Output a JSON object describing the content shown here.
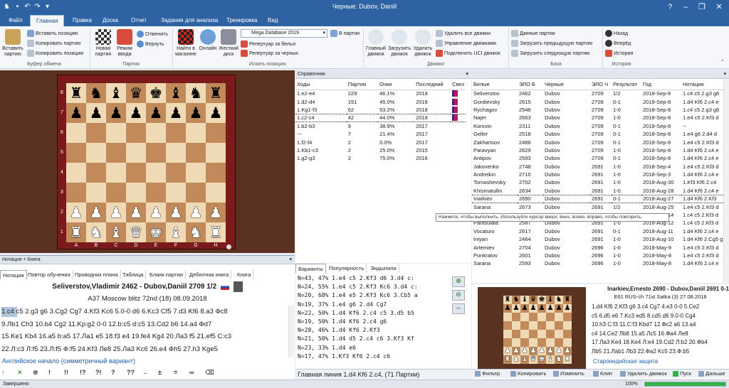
{
  "window": {
    "title": "Черные: Dubov, Daniil"
  },
  "menu": {
    "tabs": [
      "Файл",
      "Главная",
      "Правка",
      "Доска",
      "Отчет",
      "Задания для анализа",
      "Тренировка",
      "Вид"
    ]
  },
  "ribbon": {
    "paste": "Вставить\nпартию",
    "insert_pos": "Вставить позицию",
    "copy_game": "Копировать партию",
    "copy_pos": "Копировать позицию",
    "grp_clip": "Буфер обмена",
    "new_game": "Новая\nпартия",
    "input_mode": "Режим\nввода",
    "undo": "Отменить",
    "redo": "Вернуть",
    "grp_game": "Партия",
    "find_shop": "Найти в\nмагазине",
    "online": "Онлайн",
    "hard_disk": "Жесткий\nдиск",
    "database_value": "Mega Database 2019",
    "in_game": "В партии",
    "rep_white": "Репертуар за белых",
    "rep_black": "Репертуар за черных",
    "grp_search": "Искать позицию",
    "main_engine": "Главный\nдвижок",
    "load_engine": "Загрузить\nдвижок",
    "remove_engine": "Удалить\nдвижок",
    "remove_all": "Удалить все движки",
    "manage": "Управление движками",
    "uci": "Подключить UCI движок",
    "grp_engines": "Движки",
    "game_data": "Данные партии",
    "load_prev": "Загрузить предыдущую партию",
    "load_next": "Загрузить следующую партию",
    "grp_base": "База",
    "back": "Назад",
    "forward": "Вперёд",
    "history": "История",
    "grp_history": "История"
  },
  "board": {
    "ranks": [
      "8",
      "7",
      "6",
      "5",
      "4",
      "3",
      "2",
      "1"
    ],
    "files": [
      "A",
      "B",
      "C",
      "D",
      "E",
      "F",
      "G",
      "H"
    ],
    "position": [
      [
        "r",
        "n",
        "b",
        "q",
        "k",
        "b",
        "n",
        "r"
      ],
      [
        "p",
        "p",
        "p",
        "p",
        "p",
        "p",
        "p",
        "p"
      ],
      [
        "",
        "",
        "",
        "",
        "",
        "",
        "",
        ""
      ],
      [
        "",
        "",
        "",
        "",
        "",
        "",
        "",
        ""
      ],
      [
        "",
        "",
        "",
        "",
        "",
        "",
        "",
        ""
      ],
      [
        "",
        "",
        "",
        "",
        "",
        "",
        "",
        ""
      ],
      [
        "P",
        "P",
        "P",
        "P",
        "P",
        "P",
        "P",
        "P"
      ],
      [
        "R",
        "N",
        "B",
        "Q",
        "K",
        "B",
        "N",
        "R"
      ]
    ]
  },
  "notation": {
    "header": "Нотация + Книга",
    "tabs": [
      "Нотация",
      "Повтор обучения",
      "Проводник плана",
      "Таблица",
      "Бланк партии",
      "Дебютная книга",
      "Книга"
    ],
    "players": "Seliverstov,Vladimir 2462 - Dubov,Daniil 2709  1/2",
    "event": "A37 Moscow blitz 72nd (18) 08.09.2018",
    "lines": [
      "1.c4  c5 2.g3 g6 3.Cg2 Cg7 4.Kf3 Kc6 5.0-0 d6 6.Kc3 Cf5 7.d3 Kf6 8.a3 Фc8",
      "9.Лb1 Ch3 10.b4 Cg2 11.Kp:g2 0-0 12.b:c5 d:c5 13.Cd2 b6 14.a4 Фd7",
      "15.Ke1 Kb4 16.a5 b:a5 17.Лa1 e5 18.f3 e4 19.fe4 Kg4 20.Лa3 f5 21.ef5 C:c3",
      "22.Л:c3 Л:f5 23.Л:f5 Ф:f5 24.Kf3 Лe8 25.Лa3 Kc6 26.e4 Фh5 27.h3 Kge5"
    ],
    "opening": "Английское начало (симметричный вариант)",
    "symbols": [
      "↑",
      "✕",
      "⊕",
      "!",
      "!!",
      "!?",
      "?!",
      "?",
      "??",
      "←",
      "±",
      "=",
      "∞",
      "⌫"
    ]
  },
  "reference": {
    "header": "Справочник",
    "columns": [
      "Ходы",
      "Партии",
      "Очки",
      "Последний",
      "Свез"
    ],
    "rows": [
      [
        "1.e2-e4",
        "229",
        "46.1%",
        "2018"
      ],
      [
        "1.d2-d4",
        "191",
        "45.0%",
        "2018"
      ],
      [
        "1.Kg1-f3",
        "62",
        "53.2%",
        "2018"
      ],
      [
        "1.c2-c4",
        "42",
        "44.0%",
        "2018"
      ],
      [
        "1.b2-b3",
        "9",
        "38.9%",
        "2017"
      ],
      [
        "---",
        "7",
        "21.4%",
        "2017"
      ],
      [
        "1.f2-f4",
        "2",
        "0.0%",
        "2017"
      ],
      [
        "1.Kb1-c3",
        "2",
        "25.0%",
        "2015"
      ],
      [
        "1.g2-g3",
        "2",
        "75.0%",
        "2016"
      ]
    ],
    "selected_row": 3
  },
  "variants": {
    "tabs": [
      "Варианты",
      "Популярность",
      "Эндшпили"
    ],
    "lines": [
      "N=43, 47%  1.e4 c5 2.Kf3 d6 3.d4 c:",
      "N=24, 55%  1.e4 c5 2.Kf3 Kc6 3.d4 c:",
      "N=20, 68%  1.e4 e5 2.Kf3 Kc6 3.Cb5 a",
      "N=19, 37%  1.e4 g6 2.d4 Cg7",
      "N=22, 50%  1.d4 Kf6 2.c4 c5 3.d5 b5",
      "N=19, 50%  1.d4 Kf6 2.c4 g6",
      "N=28, 46%  1.d4 Kf6 2.Kf3",
      "N=21, 50%  1.d4 d5 2.c4 c6 3.Kf3 Kf",
      "N=23, 33%  1.d4 e6",
      "N=17, 47%  1.Kf3 Kf6 2.c4 c6"
    ],
    "footer": "Главная линия 1.d4 Kf6 2.c4, (71 Партии)"
  },
  "games": {
    "columns": [
      "Белые",
      "ЭЛО Б",
      "Черные",
      "ЭЛО Ч",
      "Результат",
      "Год",
      "Нотация"
    ],
    "rows": [
      [
        "Seliverstov",
        "2462",
        "Dubov",
        "2709",
        "1/2",
        "2018-Sep-8",
        "1.c4 c5 2.g3 g6"
      ],
      [
        "Gordievsky",
        "2615",
        "Dubov",
        "2709",
        "0-1",
        "2018-Sep-8",
        "1.d4 Kf6 2.c4 e"
      ],
      [
        "Rychagov",
        "2548",
        "Dubov",
        "2709",
        "1-0",
        "2018-Sep-8",
        "1.c4 c5 2.g3 g6"
      ],
      [
        "Najer",
        "2663",
        "Dubov",
        "2709",
        "1-0",
        "2018-Sep-8",
        "1.e4 c5 2.Kf3 d"
      ],
      [
        "Korovin",
        "2311",
        "Dubov",
        "2709",
        "0-1",
        "2018-Sep-8",
        "--"
      ],
      [
        "Geller",
        "2518",
        "Dubov",
        "2709",
        "0-1",
        "2018-Sep-8",
        "1.e4 g6 2.d4 d"
      ],
      [
        "Zakhartsov",
        "2486",
        "Dubov",
        "2709",
        "0-1",
        "2018-Sep-8",
        "1.e4 c5 2.Kf3 d"
      ],
      [
        "Paravyan",
        "2629",
        "Dubov",
        "2709",
        "1-0",
        "2018-Sep-8",
        "1.d4 Kf6 2.c4 e"
      ],
      [
        "Antipov",
        "2593",
        "Dubov",
        "2709",
        "0-1",
        "2018-Sep-8",
        "1.d4 Kf6 2.c4 e"
      ],
      [
        "Jakovenko",
        "2748",
        "Dubov",
        "2691",
        "1-0",
        "2018-Sep-4",
        "1.e4 c5 2.Kf3 d"
      ],
      [
        "Andreikin",
        "2710",
        "Dubov",
        "2691",
        "1-0",
        "2018-Sep-3",
        "1.d4 Kf6 2.c4 e"
      ],
      [
        "Tomashevsky",
        "2702",
        "Dubov",
        "2691",
        "1-0",
        "2018-Aug-30",
        "1.Kf3 Kf6 2.c4"
      ],
      [
        "Khismatullin",
        "2634",
        "Dubov",
        "2691",
        "1-0",
        "2018-Aug-28",
        "1.d4 Kf6 2.c4 e"
      ],
      [
        "Inarkiev",
        "2690",
        "Dubov",
        "2691",
        "0-1",
        "2018-Aug-27",
        "1.d4 Kf6 2.Kf3"
      ],
      [
        "Sarana",
        "2673",
        "Dubov",
        "2691",
        "1/2",
        "2018-Aug-25",
        "1.e4 c5 2.Kf3 d"
      ],
      [
        "Rodshtein",
        "2686",
        "Dubov",
        "2691",
        "1-0",
        "2018-Aug-14",
        "1.c4 c5 2.Kf3 d"
      ],
      [
        "Pantsulaia",
        "2587",
        "Dubov",
        "2691",
        "1-0",
        "2018-Aug-12",
        "1.c4 c5 2.Kf3 d"
      ],
      [
        "Vocaturo",
        "2617",
        "Dubov",
        "2691",
        "0-1",
        "2018-Aug-11",
        "1.d4 Kf6 2.c4 e"
      ],
      [
        "Iniyan",
        "2464",
        "Dubov",
        "2691",
        "1-0",
        "2018-Aug-10",
        "1.d4 Kf6 2.Cg5 g"
      ],
      [
        "Artemiev",
        "2704",
        "Dubov",
        "2696",
        "1-0",
        "2018-May-9",
        "1.e4 c5 2.Kf3 d"
      ],
      [
        "Ponkratov",
        "2601",
        "Dubov",
        "2696",
        "1-0",
        "2018-May-8",
        "1.e4 c5 2.Kf3 d"
      ],
      [
        "Sarana",
        "2593",
        "Dubov",
        "2696",
        "1-0",
        "2018-May-8",
        "1.d4 Kf6 2.c4 e"
      ]
    ],
    "selected_row": 13,
    "tooltip": "Нажмите, чтобы выполнить. Используйте курсор вверх, вниз, влево, вправо, чтобы повторить."
  },
  "mini": {
    "title": "Inarkiev,Ernesto 2690 - Dubov,Daniil 2691  0-1",
    "subtitle": "E61 RUS-ch 71st Satka (3) 27.08.2018",
    "moves": [
      "1.d4  Kf6 2.Kf3 g6 3.c4 Cg7 4.e3 0-0 5.Ce2",
      "c5 6.d5 e6 7.Kc3 ed5 8.cd5 d6 9.0-0 Cg4",
      "10.h3 C:f3 11.C:f3 Kbd7 12.Фc2 a6 13.a4",
      "c4 14.Ce2 Лb8 15.a5 Лc5 16.Фa4 Лe8",
      "17.Лa3 Ke4 18.Ke4 Л:e4 19.Cd2 Л:b2 20.Фb4",
      "Лb5 21.Лab1 Лb3 22.Фa2 Kc5 23.Ф:b5"
    ],
    "opening": "Староиндийская защита",
    "toolbar": [
      "Фильтр",
      "Копировать",
      "Изменить",
      "Клип",
      "Удалить движок",
      "Пуск",
      "Дальше"
    ]
  },
  "status": {
    "left": "Завершено",
    "zoom": "100%"
  }
}
